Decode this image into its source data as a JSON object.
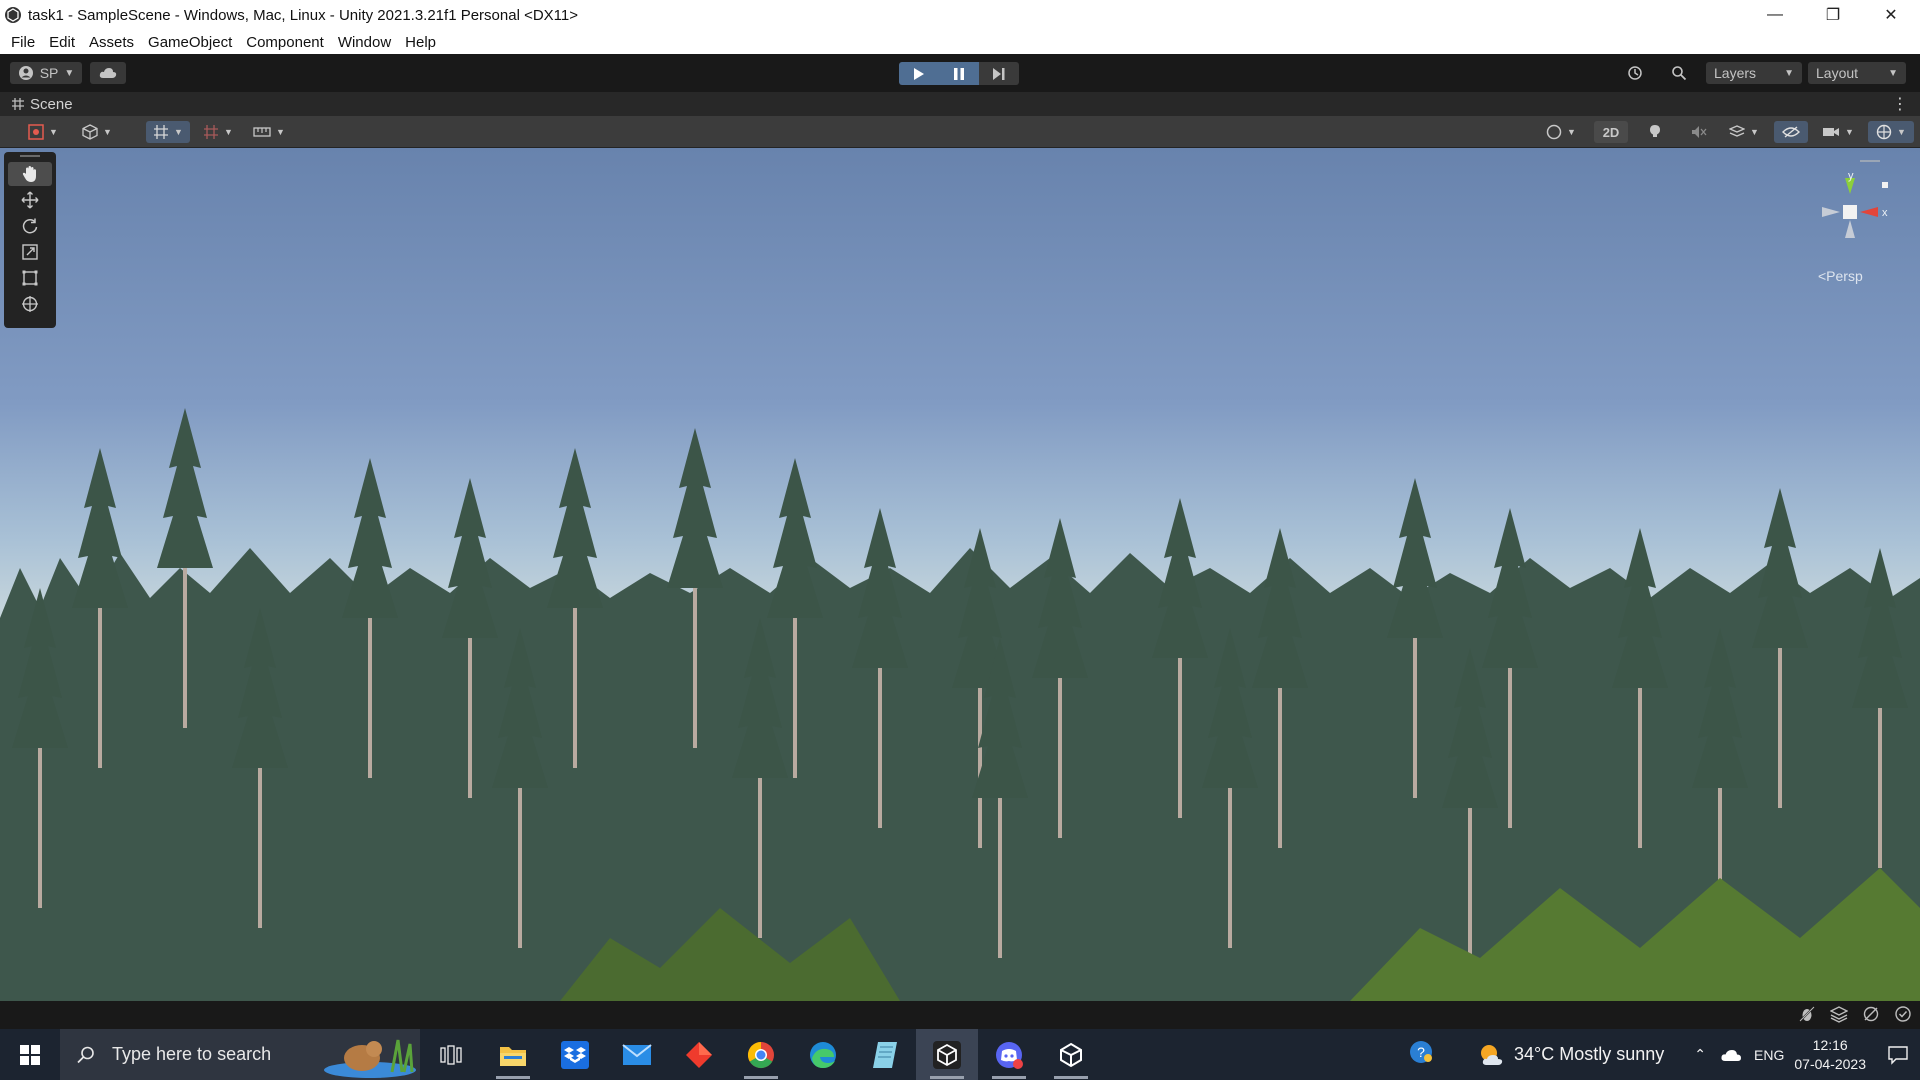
{
  "window": {
    "title": "task1 - SampleScene - Windows, Mac, Linux - Unity 2021.3.21f1 Personal <DX11>",
    "minimize_glyph": "—",
    "restore_glyph": "❐",
    "close_glyph": "✕"
  },
  "menu": [
    "File",
    "Edit",
    "Assets",
    "GameObject",
    "Component",
    "Window",
    "Help"
  ],
  "toolbar": {
    "account_label": "SP",
    "layers_label": "Layers",
    "layout_label": "Layout"
  },
  "scene_tab": {
    "label": "Scene"
  },
  "scene_toolbar": {
    "mode_2d_label": "2D"
  },
  "gizmo": {
    "y_label": "y",
    "x_label": "x",
    "projection_label": "<Persp"
  },
  "taskbar": {
    "search_placeholder": "Type here to search",
    "weather": "34°C  Mostly sunny",
    "language": "ENG",
    "time": "12:16",
    "date": "07-04-2023"
  },
  "colors": {
    "play_active": "#4f6e93",
    "editor_dark": "#191919",
    "taskbar": "#1c2430"
  }
}
